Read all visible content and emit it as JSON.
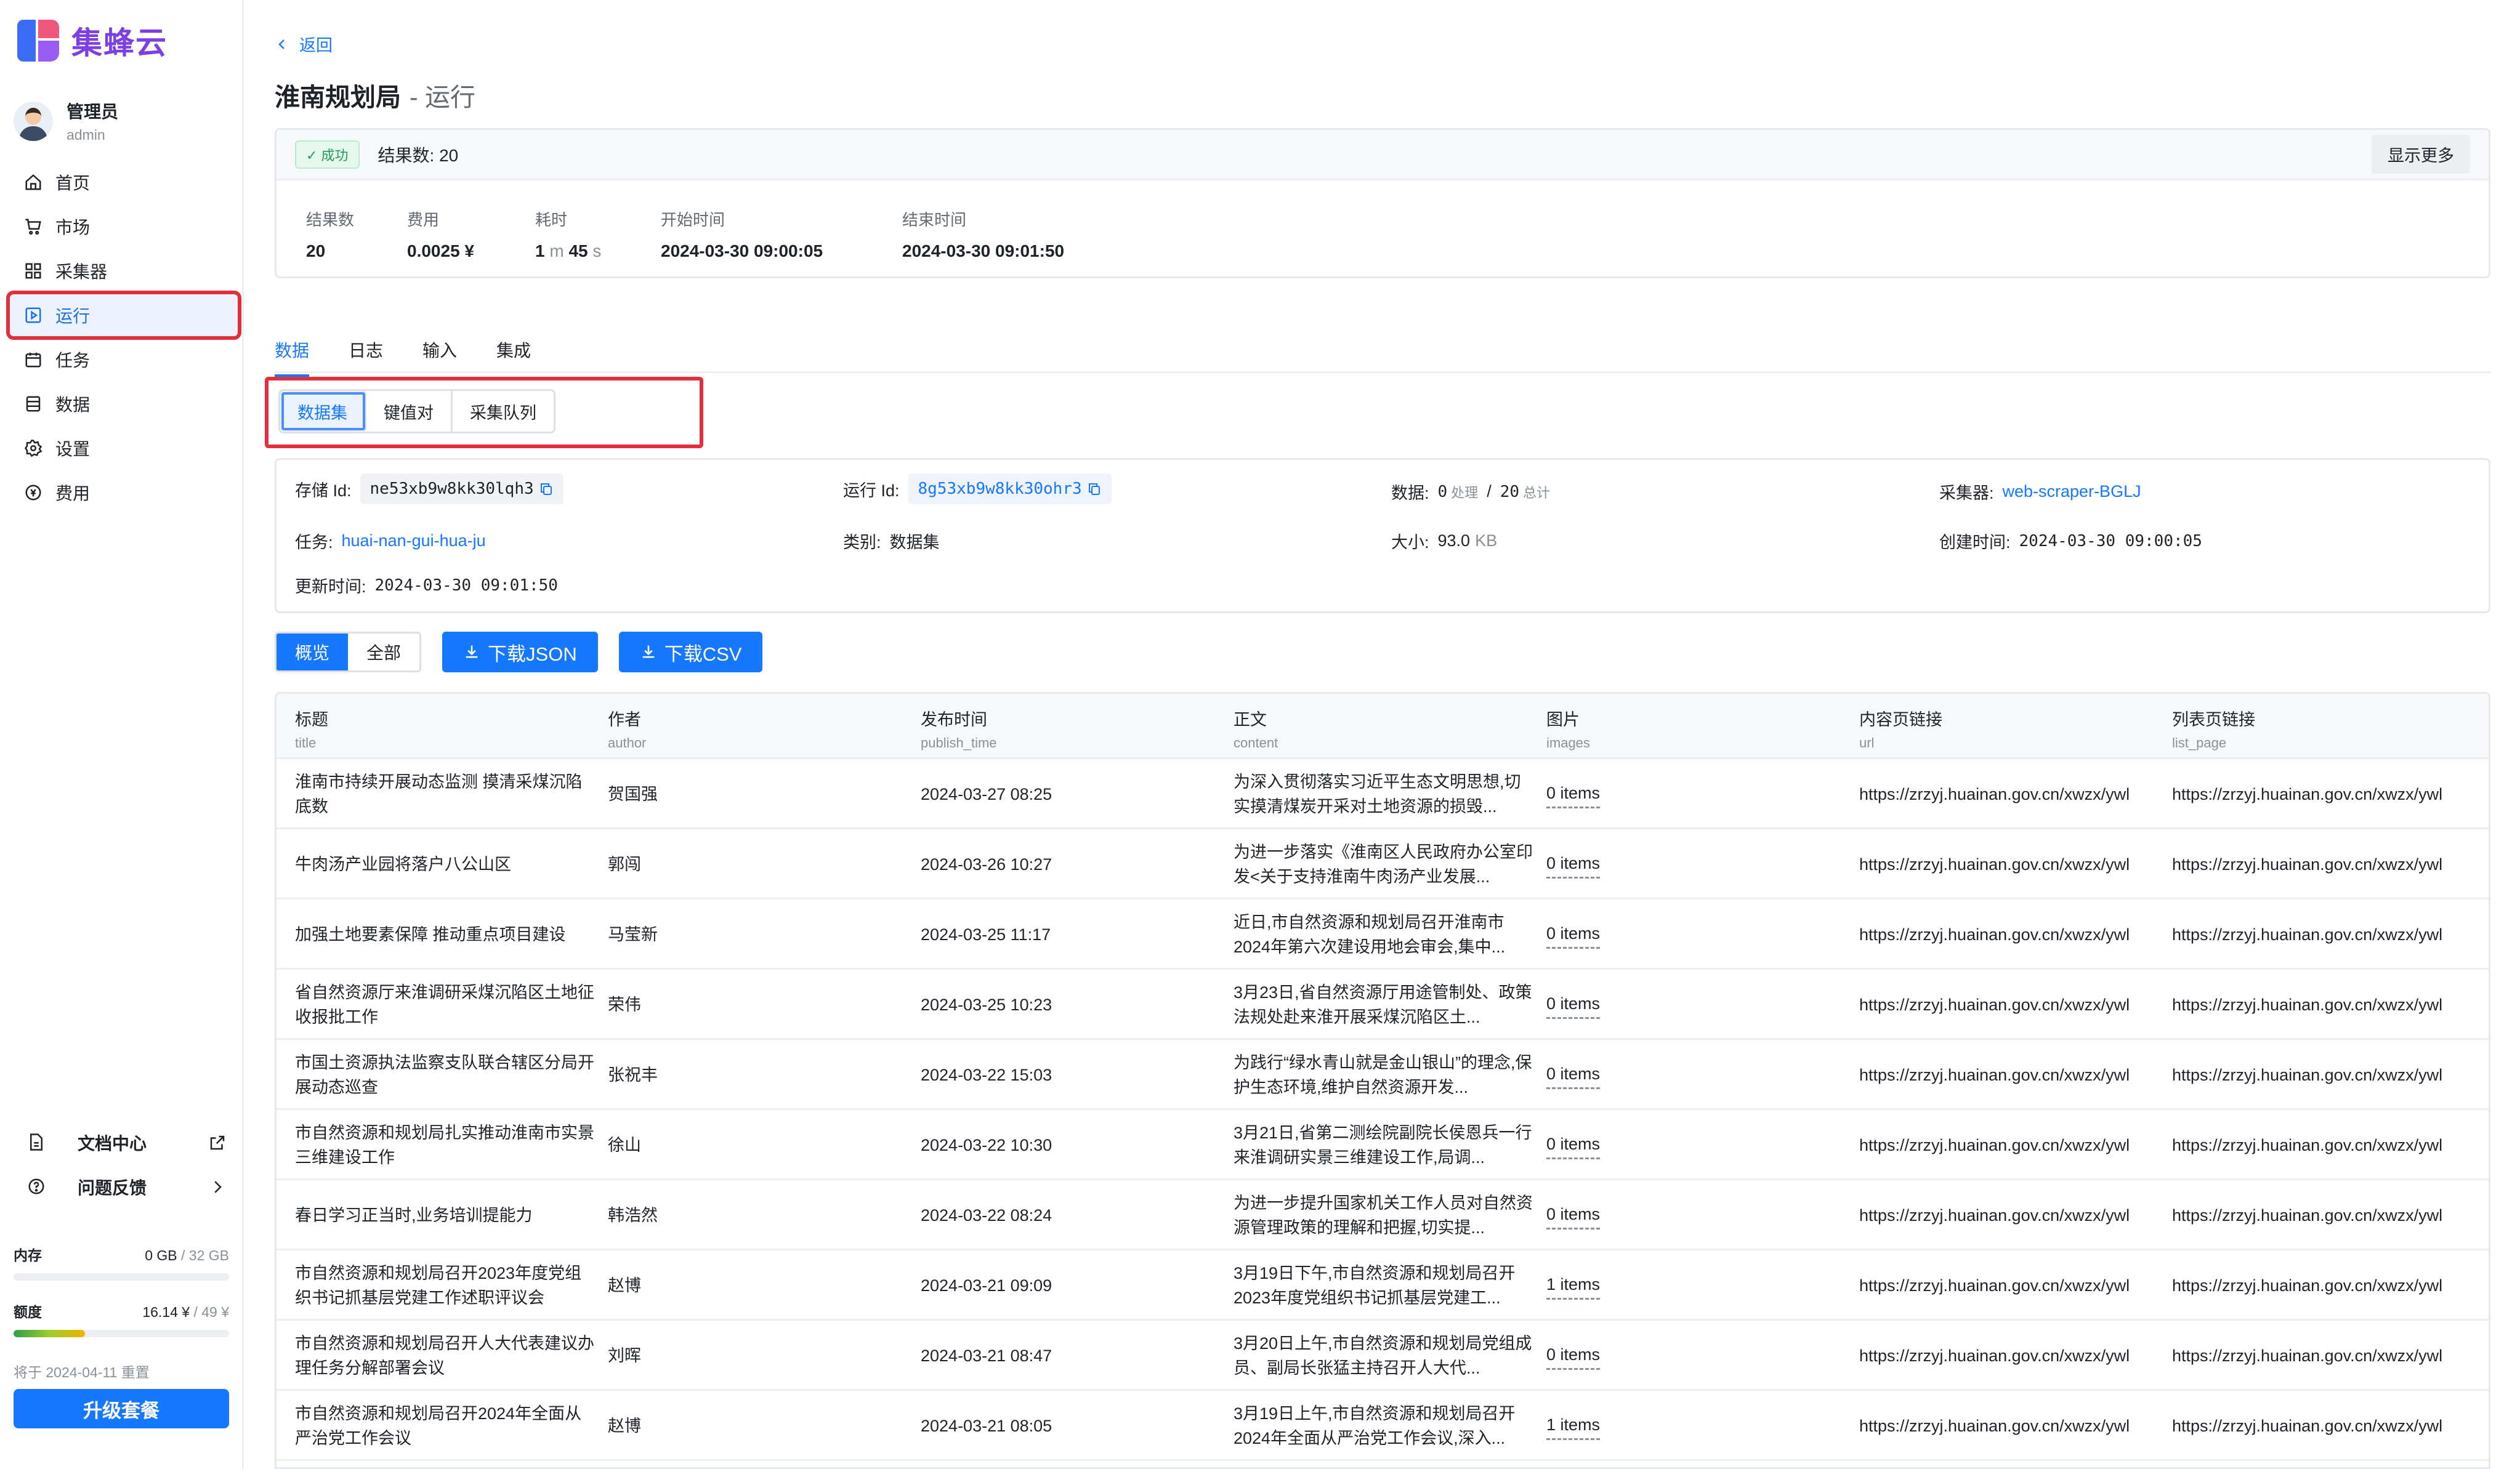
{
  "app": {
    "name": "集蜂云"
  },
  "user": {
    "name": "管理员",
    "id": "admin"
  },
  "nav": [
    {
      "key": "home",
      "label": "首页",
      "icon": "home-icon"
    },
    {
      "key": "market",
      "label": "市场",
      "icon": "cart-icon"
    },
    {
      "key": "collector",
      "label": "采集器",
      "icon": "grid-icon"
    },
    {
      "key": "run",
      "label": "运行",
      "icon": "play-square-icon",
      "active": true
    },
    {
      "key": "task",
      "label": "任务",
      "icon": "calendar-icon"
    },
    {
      "key": "data",
      "label": "数据",
      "icon": "database-icon"
    },
    {
      "key": "settings",
      "label": "设置",
      "icon": "gear-icon"
    },
    {
      "key": "billing",
      "label": "费用",
      "icon": "coin-icon"
    }
  ],
  "sidebar_bottom": {
    "docs": "文档中心",
    "feedback": "问题反馈",
    "memory": {
      "label": "内存",
      "used": "0 GB",
      "total": "32 GB",
      "fraction": 0.0
    },
    "quota": {
      "label": "额度",
      "used": "16.14 ¥",
      "total": "49 ¥",
      "fraction": 0.33,
      "color": "#7bbf2a"
    },
    "reset_note": "将于 2024-04-11 重置",
    "upgrade": "升级套餐"
  },
  "header": {
    "back": "返回",
    "title": "淮南规划局",
    "subtitle": "- 运行"
  },
  "summary": {
    "status": "✓ 成功",
    "result_count": "结果数: 20",
    "show_more": "显示更多",
    "stats": [
      {
        "label": "结果数",
        "value": "20"
      },
      {
        "label": "费用",
        "value": "0.0025 ¥"
      },
      {
        "label": "耗时",
        "value_parts": [
          "1",
          " m ",
          "45",
          " s"
        ]
      },
      {
        "label": "开始时间",
        "value": "2024-03-30 09:00:05"
      },
      {
        "label": "结束时间",
        "value": "2024-03-30 09:01:50"
      }
    ]
  },
  "tabs": [
    "数据",
    "日志",
    "输入",
    "集成"
  ],
  "sub_tabs": [
    "数据集",
    "键值对",
    "采集队列"
  ],
  "meta": {
    "storage_id_label": "存储 Id:",
    "storage_id": "ne53xb9w8kk30lqh3",
    "run_id_label": "运行 Id:",
    "run_id": "8g53xb9w8kk30ohr3",
    "data_label": "数据:",
    "processed": "0",
    "processed_unit": "处理",
    "total": "20",
    "total_unit": "总计",
    "slash": "/",
    "collector_label": "采集器:",
    "collector": "web-scraper-BGLJ",
    "task_label": "任务:",
    "task": "huai-nan-gui-hua-ju",
    "type_label": "类别:",
    "type": "数据集",
    "size_label": "大小:",
    "size": "93.0",
    "size_unit": "KB",
    "created_label": "创建时间:",
    "created": "2024-03-30 09:00:05",
    "updated_label": "更新时间:",
    "updated": "2024-03-30 09:01:50"
  },
  "actions": {
    "overview": "概览",
    "all": "全部",
    "download_json": "下载JSON",
    "download_csv": "下载CSV"
  },
  "table": {
    "columns": [
      {
        "zh": "标题",
        "en": "title"
      },
      {
        "zh": "作者",
        "en": "author"
      },
      {
        "zh": "发布时间",
        "en": "publish_time"
      },
      {
        "zh": "正文",
        "en": "content"
      },
      {
        "zh": "图片",
        "en": "images"
      },
      {
        "zh": "内容页链接",
        "en": "url"
      },
      {
        "zh": "列表页链接",
        "en": "list_page"
      }
    ],
    "rows": [
      [
        "淮南市持续开展动态监测 摸清采煤沉陷底数",
        "贺国强",
        "2024-03-27 08:25",
        "为深入贯彻落实习近平生态文明思想,切实摸清煤炭开采对土地资源的损毁...",
        "0 items",
        "https://zrzyj.huainan.gov.cn/xwzx/ywl",
        "https://zrzyj.huainan.gov.cn/xwzx/ywl"
      ],
      [
        "牛肉汤产业园将落户八公山区",
        "郭闯",
        "2024-03-26 10:27",
        "为进一步落实《淮南区人民政府办公室印发<关于支持淮南牛肉汤产业发展...",
        "0 items",
        "https://zrzyj.huainan.gov.cn/xwzx/ywl",
        "https://zrzyj.huainan.gov.cn/xwzx/ywl"
      ],
      [
        "加强土地要素保障 推动重点项目建设",
        "马莹新",
        "2024-03-25 11:17",
        "近日,市自然资源和规划局召开淮南市2024年第六次建设用地会审会,集中...",
        "0 items",
        "https://zrzyj.huainan.gov.cn/xwzx/ywl",
        "https://zrzyj.huainan.gov.cn/xwzx/ywl"
      ],
      [
        "省自然资源厅来淮调研采煤沉陷区土地征收报批工作",
        "荣伟",
        "2024-03-25 10:23",
        "3月23日,省自然资源厅用途管制处、政策法规处赴来淮开展采煤沉陷区土...",
        "0 items",
        "https://zrzyj.huainan.gov.cn/xwzx/ywl",
        "https://zrzyj.huainan.gov.cn/xwzx/ywl"
      ],
      [
        "市国土资源执法监察支队联合辖区分局开展动态巡查",
        "张祝丰",
        "2024-03-22 15:03",
        "为践行“绿水青山就是金山银山”的理念,保护生态环境,维护自然资源开发...",
        "0 items",
        "https://zrzyj.huainan.gov.cn/xwzx/ywl",
        "https://zrzyj.huainan.gov.cn/xwzx/ywl"
      ],
      [
        "市自然资源和规划局扎实推动淮南市实景三维建设工作",
        "徐山",
        "2024-03-22 10:30",
        "3月21日,省第二测绘院副院长侯恩兵一行来淮调研实景三维建设工作,局调...",
        "0 items",
        "https://zrzyj.huainan.gov.cn/xwzx/ywl",
        "https://zrzyj.huainan.gov.cn/xwzx/ywl"
      ],
      [
        "春日学习正当时,业务培训提能力",
        "韩浩然",
        "2024-03-22 08:24",
        "为进一步提升国家机关工作人员对自然资源管理政策的理解和把握,切实提...",
        "0 items",
        "https://zrzyj.huainan.gov.cn/xwzx/ywl",
        "https://zrzyj.huainan.gov.cn/xwzx/ywl"
      ],
      [
        "市自然资源和规划局召开2023年度党组织书记抓基层党建工作述职评议会",
        "赵博",
        "2024-03-21 09:09",
        "3月19日下午,市自然资源和规划局召开2023年度党组织书记抓基层党建工...",
        "1 items",
        "https://zrzyj.huainan.gov.cn/xwzx/ywl",
        "https://zrzyj.huainan.gov.cn/xwzx/ywl"
      ],
      [
        "市自然资源和规划局召开人大代表建议办理任务分解部署会议",
        "刘晖",
        "2024-03-21 08:47",
        "3月20日上午,市自然资源和规划局党组成员、副局长张猛主持召开人大代...",
        "0 items",
        "https://zrzyj.huainan.gov.cn/xwzx/ywl",
        "https://zrzyj.huainan.gov.cn/xwzx/ywl"
      ],
      [
        "市自然资源和规划局召开2024年全面从严治党工作会议",
        "赵博",
        "2024-03-21 08:05",
        "3月19日上午,市自然资源和规划局召开2024年全面从严治党工作会议,深入...",
        "1 items",
        "https://zrzyj.huainan.gov.cn/xwzx/ywl",
        "https://zrzyj.huainan.gov.cn/xwzx/ywl"
      ]
    ]
  }
}
